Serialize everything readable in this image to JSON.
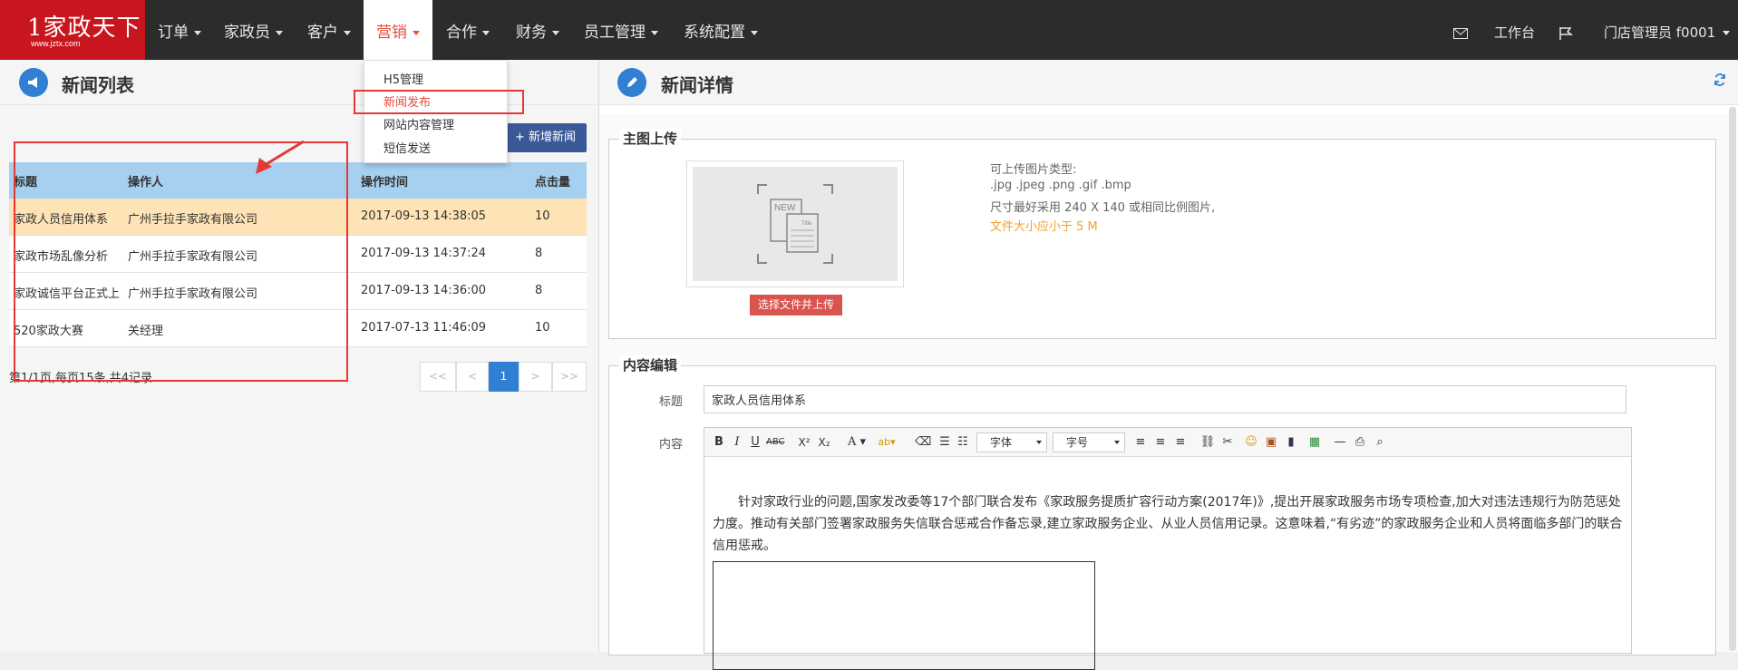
{
  "logo": {
    "main": "1家政天下",
    "sub": "www.jztx.com"
  },
  "nav": {
    "items": [
      "订单",
      "家政员",
      "客户",
      "营销",
      "合作",
      "财务",
      "员工管理",
      "系统配置"
    ],
    "active_index": 3,
    "right": {
      "workbench": "工作台",
      "user": "门店管理员 f0001"
    }
  },
  "dropdown": {
    "items": [
      "H5管理",
      "新闻发布",
      "网站内容管理",
      "短信发送"
    ]
  },
  "left": {
    "title": "新闻列表",
    "add_button": "+ 新增新闻",
    "table": {
      "headers": [
        "标题",
        "操作人",
        "操作时间",
        "点击量"
      ],
      "rows": [
        {
          "title": "家政人员信用体系",
          "operator": "广州手拉手家政有限公司",
          "time": "2017-09-13 14:38:05",
          "clicks": "10"
        },
        {
          "title": "家政市场乱像分析",
          "operator": "广州手拉手家政有限公司",
          "time": "2017-09-13 14:37:24",
          "clicks": "8"
        },
        {
          "title": "家政诚信平台正式上",
          "operator": "广州手拉手家政有限公司",
          "time": "2017-09-13 14:36:00",
          "clicks": "8"
        },
        {
          "title": "520家政大赛",
          "operator": "关经理",
          "time": "2017-07-13 11:46:09",
          "clicks": "10"
        }
      ]
    },
    "pager": {
      "info": "第1/1页,每页15条,共4记录",
      "first": "<<",
      "prev": "<",
      "current": "1",
      "next": ">",
      "last": ">>"
    }
  },
  "right": {
    "title": "新闻详情",
    "upload_section": {
      "legend": "主图上传",
      "placeholder_text_new": "NEW",
      "placeholder_text_title": "Title",
      "button": "选择文件并上传",
      "hints": [
        "可上传图片类型:",
        ".jpg .jpeg .png .gif .bmp",
        "尺寸最好采用 240 X 140 或相同比例图片,",
        "文件大小应小于 5 M"
      ]
    },
    "content_section": {
      "legend": "内容编辑",
      "title_label": "标题",
      "title_value": "家政人员信用体系",
      "content_label": "内容",
      "toolbar": {
        "font": "字体",
        "size": "字号"
      },
      "body": "针对家政行业的问题,国家发改委等17个部门联合发布《家政服务提质扩容行动方案(2017年)》,提出开展家政服务市场专项检查,加大对违法违规行为防范惩处力度。推动有关部门签署家政服务失信联合惩戒合作备忘录,建立家政服务企业、从业人员信用记录。这意味着,“有劣迹”的家政服务企业和人员将面临多部门的联合信用惩戒。"
    }
  },
  "colors": {
    "brand": "#c9151e",
    "nav_bg": "#2c2c2c",
    "accent": "#2f7fd3",
    "annotation": "#e53935",
    "selected_row": "#fde3b5"
  }
}
